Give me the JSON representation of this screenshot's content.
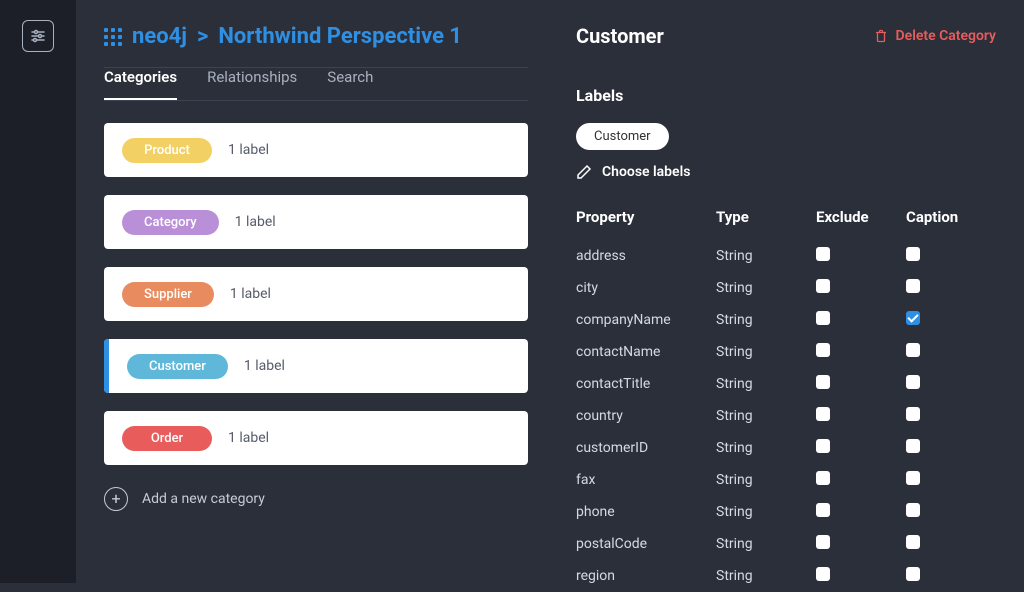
{
  "breadcrumb": {
    "db": "neo4j",
    "sep": ">",
    "perspective": "Northwind Perspective 1"
  },
  "tabs": {
    "categories": "Categories",
    "relationships": "Relationships",
    "search": "Search",
    "active": "categories"
  },
  "categories": [
    {
      "label": "Product",
      "sub": "1 label",
      "color": "#F3D064",
      "selected": false
    },
    {
      "label": "Category",
      "sub": "1 label",
      "color": "#B98FD8",
      "selected": false
    },
    {
      "label": "Supplier",
      "sub": "1 label",
      "color": "#E88B5E",
      "selected": false
    },
    {
      "label": "Customer",
      "sub": "1 label",
      "color": "#5FB8D9",
      "selected": true
    },
    {
      "label": "Order",
      "sub": "1 label",
      "color": "#E85C5C",
      "selected": false
    }
  ],
  "add_category_label": "Add a new category",
  "detail": {
    "title": "Customer",
    "delete_label": "Delete Category",
    "labels_section": "Labels",
    "label_chip": "Customer",
    "choose_labels": "Choose labels",
    "headers": {
      "property": "Property",
      "type": "Type",
      "exclude": "Exclude",
      "caption": "Caption"
    },
    "properties": [
      {
        "name": "address",
        "type": "String",
        "exclude": false,
        "caption": false
      },
      {
        "name": "city",
        "type": "String",
        "exclude": false,
        "caption": false
      },
      {
        "name": "companyName",
        "type": "String",
        "exclude": false,
        "caption": true
      },
      {
        "name": "contactName",
        "type": "String",
        "exclude": false,
        "caption": false
      },
      {
        "name": "contactTitle",
        "type": "String",
        "exclude": false,
        "caption": false
      },
      {
        "name": "country",
        "type": "String",
        "exclude": false,
        "caption": false
      },
      {
        "name": "customerID",
        "type": "String",
        "exclude": false,
        "caption": false
      },
      {
        "name": "fax",
        "type": "String",
        "exclude": false,
        "caption": false
      },
      {
        "name": "phone",
        "type": "String",
        "exclude": false,
        "caption": false
      },
      {
        "name": "postalCode",
        "type": "String",
        "exclude": false,
        "caption": false
      },
      {
        "name": "region",
        "type": "String",
        "exclude": false,
        "caption": false
      }
    ]
  }
}
